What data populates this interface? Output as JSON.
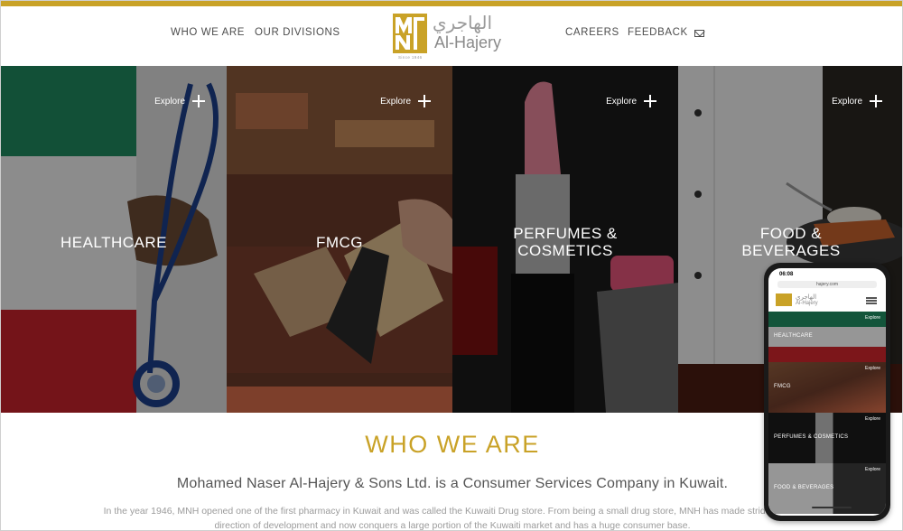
{
  "nav": {
    "left_items": [
      "WHO WE ARE",
      "OUR DIVISIONS"
    ],
    "right_items": [
      "CAREERS",
      "FEEDBACK"
    ]
  },
  "logo": {
    "arabic": "الهاجري",
    "english": "Al-Hajery",
    "since": "Since 1946"
  },
  "panels": [
    {
      "title_lines": [
        "HEALTHCARE"
      ],
      "explore": "Explore"
    },
    {
      "title_lines": [
        "FMCG"
      ],
      "explore": "Explore"
    },
    {
      "title_lines": [
        "PERFUMES &",
        "COSMETICS"
      ],
      "explore": "Explore"
    },
    {
      "title_lines": [
        "FOOD &",
        "BEVERAGES"
      ],
      "explore": "Explore"
    }
  ],
  "about": {
    "title": "WHO WE ARE",
    "subtitle": "Mohamed Naser Al-Hajery & Sons Ltd. is a Consumer Services Company in Kuwait.",
    "body": "In the year 1946, MNH opened one of the first pharmacy in Kuwait and was called the Kuwaiti Drug store. From being a small drug store, MNH has made strides in the direction of development and now conquers a large portion of the Kuwaiti market and has a huge consumer base."
  },
  "phone": {
    "time": "06:08",
    "url": "hajery.com",
    "tiles": [
      {
        "label": "HEALTHCARE",
        "explore": "Explore"
      },
      {
        "label": "FMCG",
        "explore": "Explore"
      },
      {
        "label": "PERFUMES & COSMETICS",
        "explore": "Explore"
      },
      {
        "label": "FOOD & BEVERAGES",
        "explore": "Explore"
      }
    ]
  },
  "colors": {
    "accent": "#c9a227",
    "nav_text": "#4d4d4d"
  }
}
